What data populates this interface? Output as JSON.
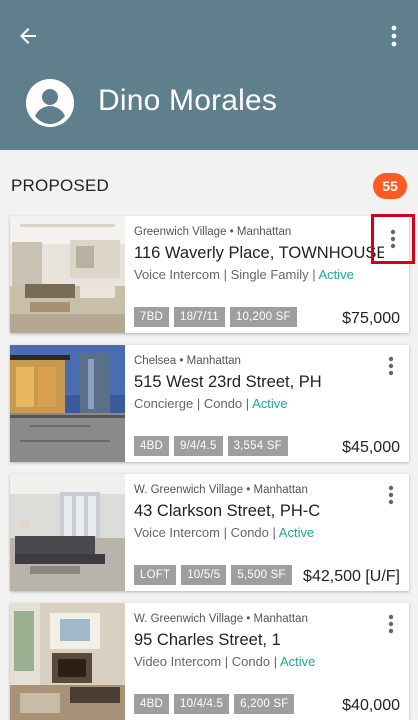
{
  "header": {
    "profile_name": "Dino Morales",
    "bg_color": "#5f7f8c"
  },
  "section": {
    "title": "PROPOSED",
    "count": "55",
    "badge_color": "#ff5a1f"
  },
  "listings": [
    {
      "neighborhood": "Greenwich Village • Manhattan",
      "address": "116 Waverly Place, TOWNHOUSE",
      "details": "Voice Intercom | Single Family | ",
      "status": "Active",
      "chips": [
        "7BD",
        "18/7/11",
        "10,200 SF"
      ],
      "price": "$75,000"
    },
    {
      "neighborhood": "Chelsea • Manhattan",
      "address": "515 West 23rd Street, PH",
      "details": "Concierge | Condo | ",
      "status": "Active",
      "chips": [
        "4BD",
        "9/4/4.5",
        "3,554 SF"
      ],
      "price": "$45,000"
    },
    {
      "neighborhood": "W. Greenwich Village • Manhattan",
      "address": "43 Clarkson Street, PH-C",
      "details": "Voice Intercom | Condo | ",
      "status": "Active",
      "chips": [
        "LOFT",
        "10/5/5",
        "5,500 SF"
      ],
      "price": "$42,500 [U/F]"
    },
    {
      "neighborhood": "W. Greenwich Village • Manhattan",
      "address": "95 Charles Street, 1",
      "details": "Video Intercom | Condo | ",
      "status": "Active",
      "chips": [
        "4BD",
        "10/4/4.5",
        "6,200 SF"
      ],
      "price": "$40,000"
    }
  ],
  "icons": {
    "back": "arrow-back-icon",
    "menu": "more-vert-icon",
    "avatar": "account-circle-icon"
  }
}
